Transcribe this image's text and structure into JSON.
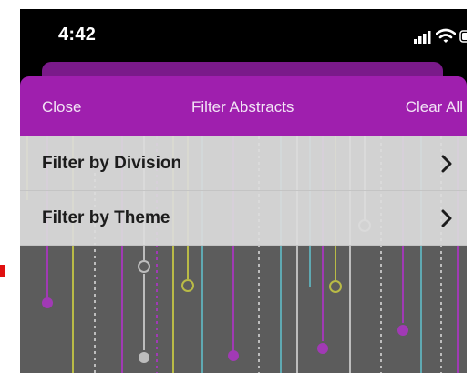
{
  "status_bar": {
    "time": "4:42",
    "icons": [
      "cellular-signal-icon",
      "wifi-icon",
      "battery-icon"
    ]
  },
  "nav": {
    "close_label": "Close",
    "title": "Filter Abstracts",
    "clear_label": "Clear All"
  },
  "filters": [
    {
      "label": "Filter by Division",
      "icon": "chevron-right-icon"
    },
    {
      "label": "Filter by Theme",
      "icon": "chevron-right-icon"
    }
  ],
  "colors": {
    "nav_background": "#9f1fae",
    "row_background": "#dcdcdc",
    "content_background": "#5c5c5c",
    "art_purple": "#a13ab5",
    "art_yellow": "#b9bb46",
    "art_teal": "#5fa9b2",
    "art_gray": "#bdbdbd"
  }
}
